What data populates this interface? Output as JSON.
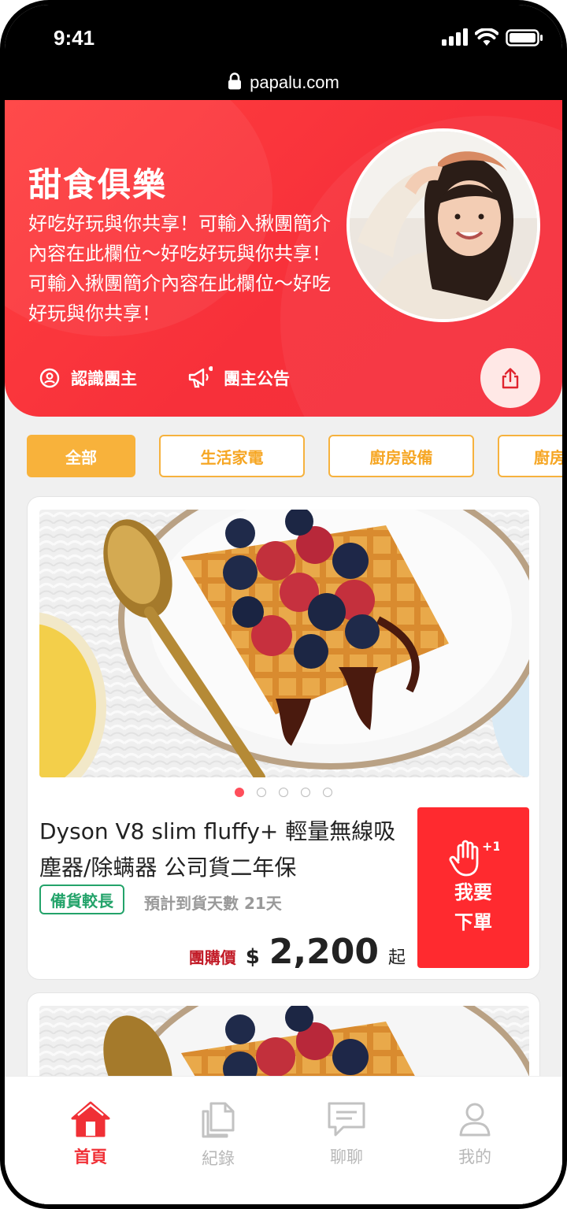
{
  "status_bar": {
    "time": "9:41",
    "url": "papalu.com"
  },
  "hero": {
    "title": "甜食俱樂",
    "description": "好吃好玩與你共享！可輸入揪團簡介內容在此欄位～好吃好玩與你共享！可輸入揪團簡介內容在此欄位～好吃好玩與你共享！",
    "links": [
      {
        "label": "認識團主",
        "icon": "user-circle-icon"
      },
      {
        "label": "團主公告",
        "icon": "megaphone-icon"
      }
    ],
    "share_icon": "share-icon"
  },
  "categories": [
    {
      "label": "全部",
      "active": true
    },
    {
      "label": "生活家電",
      "active": false
    },
    {
      "label": "廚房設備",
      "active": false
    },
    {
      "label": "廚房",
      "active": false
    }
  ],
  "product": {
    "title": "Dyson V8 slim fluffy+ 輕量無線吸塵器/除螨器 公司貨二年保",
    "badge": "備貨較長",
    "eta": "預計到貨天數 21天",
    "price_label": "團購價",
    "currency": "$",
    "price": "2,200",
    "price_suffix": "起",
    "order_button": {
      "line1": "我要",
      "line2": "下單",
      "badge": "+1"
    },
    "carousel": {
      "count": 5,
      "active_index": 0
    }
  },
  "bottom_nav": [
    {
      "label": "首頁",
      "icon": "home-icon",
      "active": true
    },
    {
      "label": "紀錄",
      "icon": "document-icon",
      "active": false
    },
    {
      "label": "聊聊",
      "icon": "chat-icon",
      "active": false
    },
    {
      "label": "我的",
      "icon": "profile-icon",
      "active": false
    }
  ],
  "colors": {
    "primary_red": "#f7303a",
    "accent_orange": "#f8b23b",
    "badge_green": "#23a36a"
  }
}
